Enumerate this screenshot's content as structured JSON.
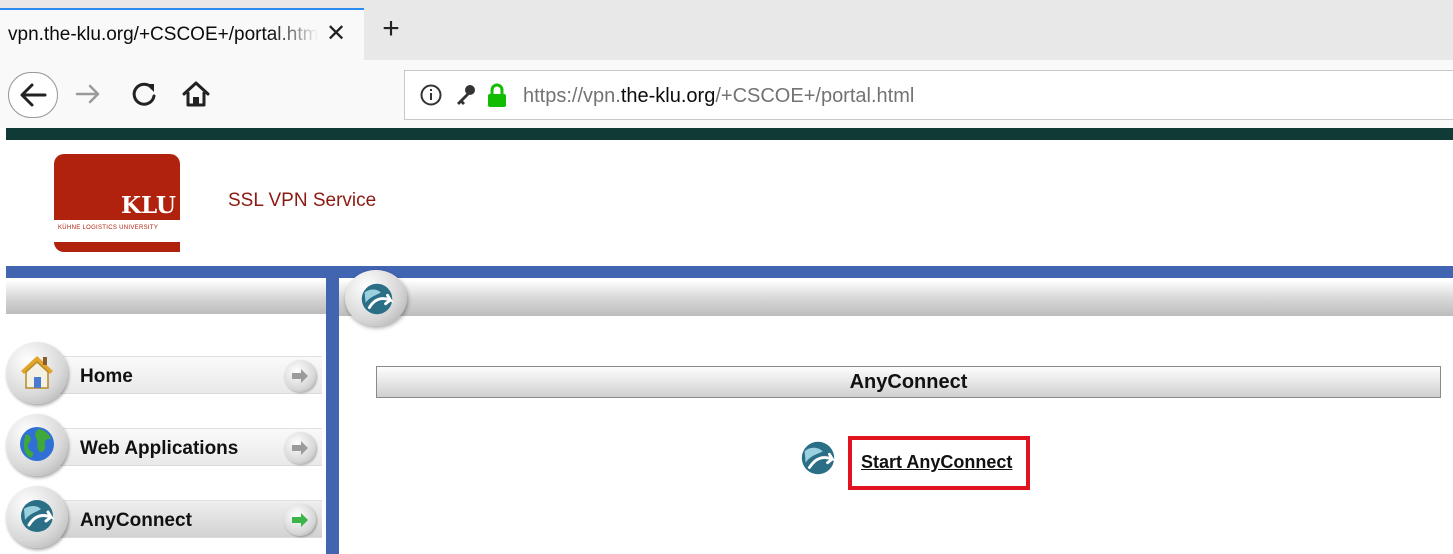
{
  "browser": {
    "tab_title": "vpn.the-klu.org/+CSCOE+/portal.html",
    "tab_close_glyph": "✕",
    "new_tab_glyph": "+",
    "url_prefix": "https://vpn.",
    "url_domain": "the-klu.org",
    "url_path": "/+CSCOE+/portal.html"
  },
  "header": {
    "logo_text": "KLU",
    "logo_subtext": "KÜHNE LOGISTICS UNIVERSITY",
    "service_title": "SSL VPN Service"
  },
  "sidebar": {
    "items": [
      {
        "label": "Home",
        "icon": "home-icon",
        "active": false
      },
      {
        "label": "Web Applications",
        "icon": "globe-icon",
        "active": false
      },
      {
        "label": "AnyConnect",
        "icon": "anyconnect-icon",
        "active": true
      }
    ]
  },
  "main": {
    "section_title": "AnyConnect",
    "start_link": "Start AnyConnect"
  },
  "colors": {
    "accent_blue": "#4265b2",
    "top_strip": "#0f3a36",
    "brand_red": "#b1220e",
    "highlight_red": "#e0141e",
    "active_arrow_green": "#3bb54a"
  }
}
